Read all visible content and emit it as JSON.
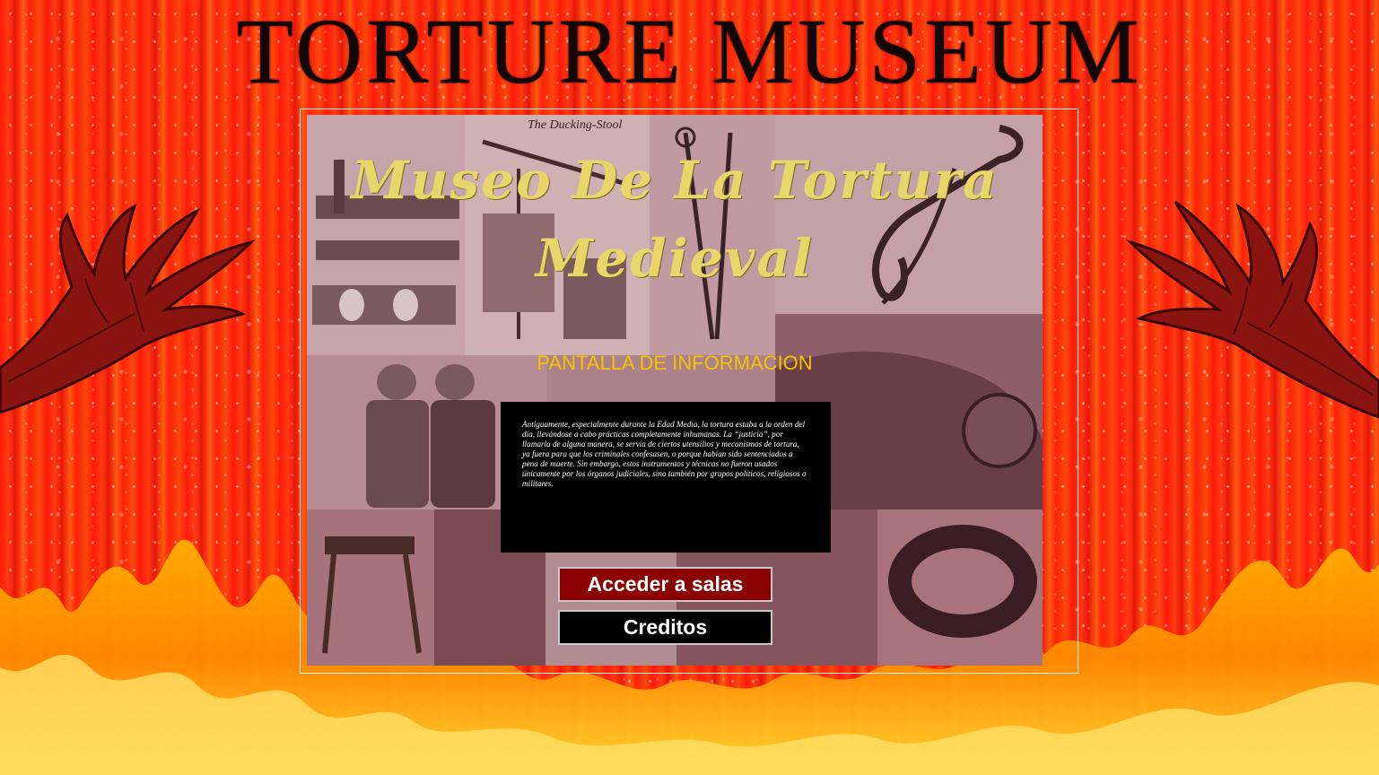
{
  "header": {
    "title": "TORTURE MUSEUM"
  },
  "main": {
    "title": "Museo De La Tortura Medieval",
    "subtitle": "PANTALLA DE INFORMACION",
    "info_text": "Antiguamente, especialmente durante la Edad Media, la tortura estaba a la orden del día, llevándose a cabo prácticas completamente inhumanas. La “justicia”, por llamarla de alguna manera, se servía de ciertos utensilios y mecanismos de tortura, ya fuera para que los criminales confesasen, o porque habían sido sentenciados a pena de muerte. Sin embargo, estos instrumentos y técnicas no fueron usados únicamente por los órganos judiciales, sino también por grupos políticos, religiosos o militares.",
    "collage_caption": "The Ducking-Stool"
  },
  "buttons": {
    "salas_label": "Acceder a salas",
    "creditos_label": "Creditos"
  },
  "colors": {
    "background": "#ff2a0c",
    "title_gold": "#e8d66a",
    "subtitle_yellow": "#f4c400",
    "button_red": "#8b0000",
    "button_black": "#000000"
  }
}
